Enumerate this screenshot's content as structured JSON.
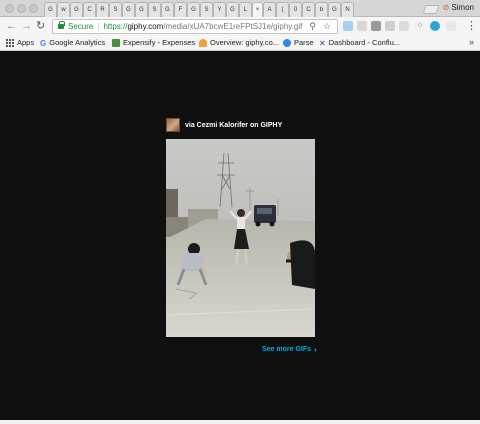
{
  "browser": {
    "tabs": [
      {
        "label": "G"
      },
      {
        "label": "w"
      },
      {
        "label": "G"
      },
      {
        "label": "C"
      },
      {
        "label": "R"
      },
      {
        "label": "S"
      },
      {
        "label": "G"
      },
      {
        "label": "G"
      },
      {
        "label": "S"
      },
      {
        "label": "G"
      },
      {
        "label": "F"
      },
      {
        "label": "G"
      },
      {
        "label": "S"
      },
      {
        "label": "Y"
      },
      {
        "label": "G"
      },
      {
        "label": "L"
      },
      {
        "label": "×"
      },
      {
        "label": "A"
      },
      {
        "label": "("
      },
      {
        "label": "0"
      },
      {
        "label": "C"
      },
      {
        "label": "b"
      },
      {
        "label": "G"
      },
      {
        "label": "N"
      }
    ],
    "profile_name": "Simon",
    "security_label": "Secure",
    "url_scheme": "https://",
    "url_host": "giphy.com",
    "url_path": "/media/xUA7bcwE1reFPtSJ1e/giphy.gif",
    "bookmarks": {
      "apps": "Apps",
      "analytics": "Google Analytics",
      "expensify": "Expensify - Expenses",
      "overview": "Overview: giphy.co...",
      "parse": "Parse",
      "dashboard": "Dashboard - Conflu...",
      "more": "»"
    },
    "colors": {
      "secure_green": "#1e8e3e",
      "link_blue": "#00b0e8",
      "page_bg": "#101010"
    }
  },
  "page": {
    "attribution": "via Cezmi Kalorifer on GIPHY",
    "see_more": "See more GIFs",
    "see_more_icon": "chevron-right-icon"
  }
}
